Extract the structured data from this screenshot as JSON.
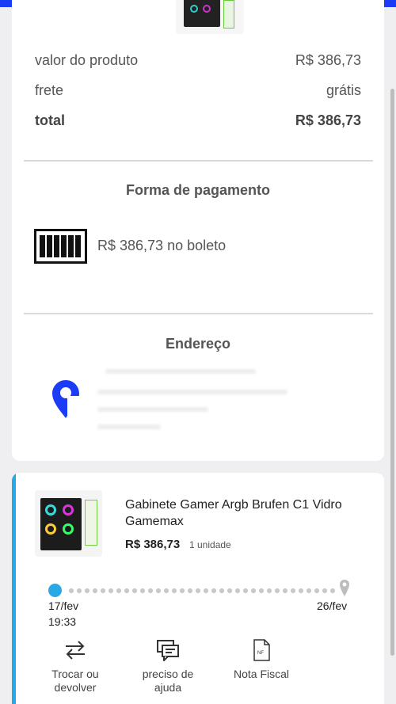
{
  "summary": {
    "product_label": "valor do produto",
    "product_value": "R$ 386,73",
    "shipping_label": "frete",
    "shipping_value": "grátis",
    "total_label": "total",
    "total_value": "R$ 386,73"
  },
  "payment": {
    "title": "Forma de pagamento",
    "method_text": "R$ 386,73 no boleto",
    "icon": "barcode-icon"
  },
  "address": {
    "title": "Endereço",
    "icon": "location-pin-icon"
  },
  "order": {
    "product_name": "Gabinete Gamer Argb Brufen C1 Vidro Gamemax",
    "price": "R$ 386,73",
    "quantity": "1 unidade",
    "start_date": "17/fev",
    "start_time": "19:33",
    "end_date": "26/fev",
    "actions": [
      {
        "label_line1": "Trocar ou",
        "label_line2": "devolver",
        "icon": "swap-arrows-icon"
      },
      {
        "label_line1": "preciso de",
        "label_line2": "ajuda",
        "icon": "chat-icon"
      },
      {
        "label_line1": "Nota Fiscal",
        "label_line2": "",
        "icon": "invoice-icon",
        "icon_text": "NF"
      }
    ]
  },
  "colors": {
    "accent": "#29a8e8",
    "top_bar": "#1a3cf5",
    "background": "#efeff1"
  }
}
